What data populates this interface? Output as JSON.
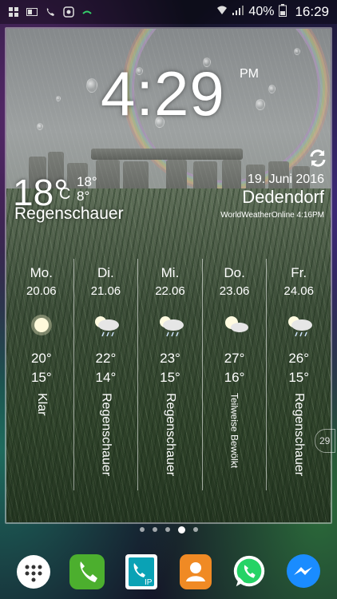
{
  "status_bar": {
    "battery": "40%",
    "time": "16:29"
  },
  "clock": {
    "time": "4:29",
    "ampm": "PM"
  },
  "current": {
    "temp": "18°",
    "unit": "C",
    "high": "18°",
    "low": "8°",
    "condition": "Regenschauer",
    "date": "19. Juni 2016",
    "location": "Dedendorf",
    "source": "WorldWeatherOnline 4:16PM"
  },
  "forecast": [
    {
      "day": "Mo.",
      "date": "20.06",
      "high": "20°",
      "low": "15°",
      "condition": "Klar",
      "icon": "sun-icon"
    },
    {
      "day": "Di.",
      "date": "21.06",
      "high": "22°",
      "low": "14°",
      "condition": "Regenschauer",
      "icon": "sun-cloud-rain-icon"
    },
    {
      "day": "Mi.",
      "date": "22.06",
      "high": "23°",
      "low": "15°",
      "condition": "Regenschauer",
      "icon": "sun-cloud-rain-icon"
    },
    {
      "day": "Do.",
      "date": "23.06",
      "high": "27°",
      "low": "16°",
      "condition": "Teilweise Bewölkt",
      "icon": "sun-cloud-icon"
    },
    {
      "day": "Fr.",
      "date": "24.06",
      "high": "26°",
      "low": "15°",
      "condition": "Regenschauer",
      "icon": "sun-cloud-rain-icon"
    }
  ],
  "edge_badge": "29",
  "colors": {
    "phone": "#4caf2e",
    "contacts": "#f08a24",
    "whatsapp": "#25d366",
    "messenger": "#1a8cff",
    "ip_call": "#0aa2b5"
  }
}
